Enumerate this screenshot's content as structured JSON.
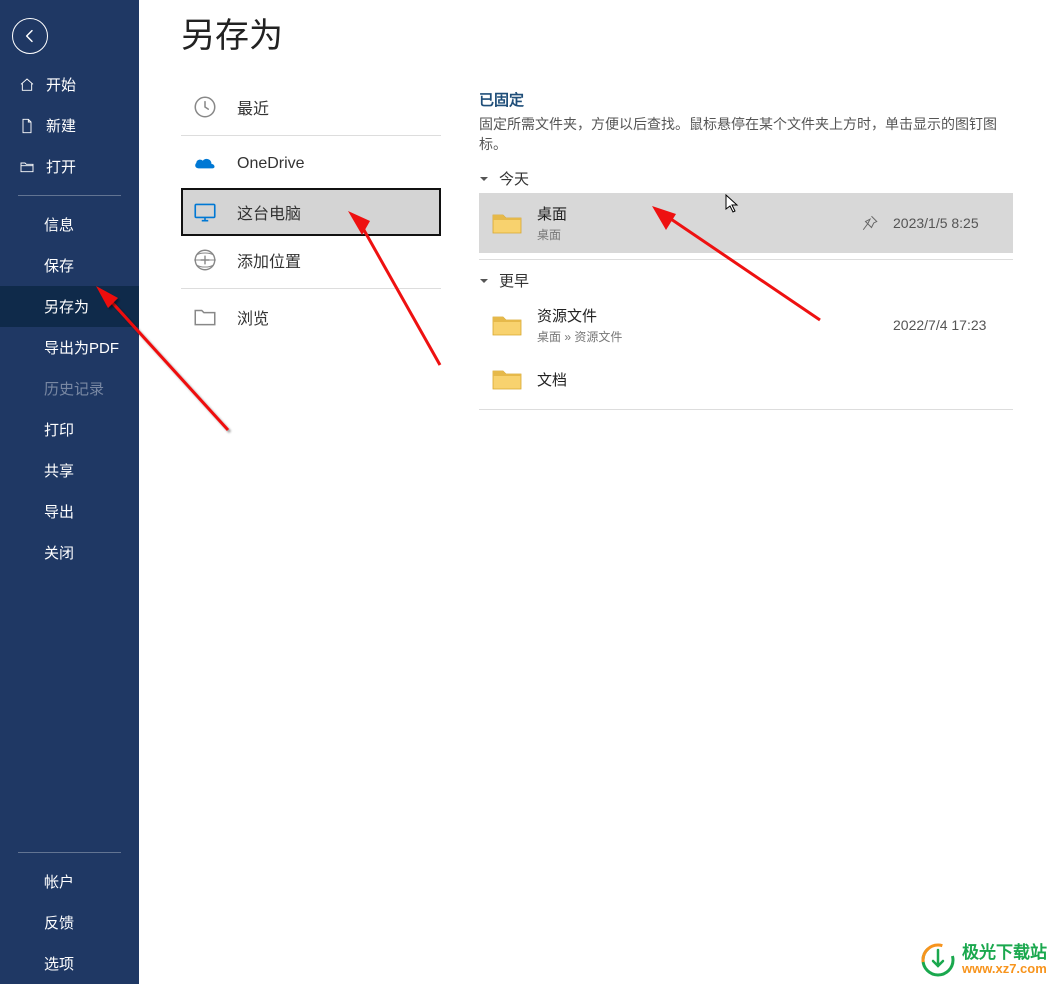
{
  "sidebar": {
    "home": "开始",
    "new": "新建",
    "open": "打开",
    "info": "信息",
    "save": "保存",
    "saveas": "另存为",
    "exportpdf": "导出为PDF",
    "history": "历史记录",
    "print": "打印",
    "share": "共享",
    "export": "导出",
    "close": "关闭",
    "account": "帐户",
    "feedback": "反馈",
    "options": "选项"
  },
  "page": {
    "title": "另存为"
  },
  "locations": [
    {
      "label": "最近"
    },
    {
      "label": "OneDrive"
    },
    {
      "label": "这台电脑"
    },
    {
      "label": "添加位置"
    },
    {
      "label": "浏览"
    }
  ],
  "pinned": {
    "title": "已固定",
    "desc": "固定所需文件夹，方便以后查找。鼠标悬停在某个文件夹上方时，单击显示的图钉图标。"
  },
  "groups": {
    "today": "今天",
    "earlier": "更早"
  },
  "folders": {
    "desktop": {
      "name": "桌面",
      "sub": "桌面",
      "date": "2023/1/5 8:25"
    },
    "resources": {
      "name": "资源文件",
      "sub": "桌面 » 资源文件",
      "date": "2022/7/4 17:23"
    },
    "documents": {
      "name": "文档",
      "sub": "",
      "date": ""
    }
  },
  "watermark": {
    "line1": "极光下载站",
    "line2": "www.xz7.com"
  }
}
